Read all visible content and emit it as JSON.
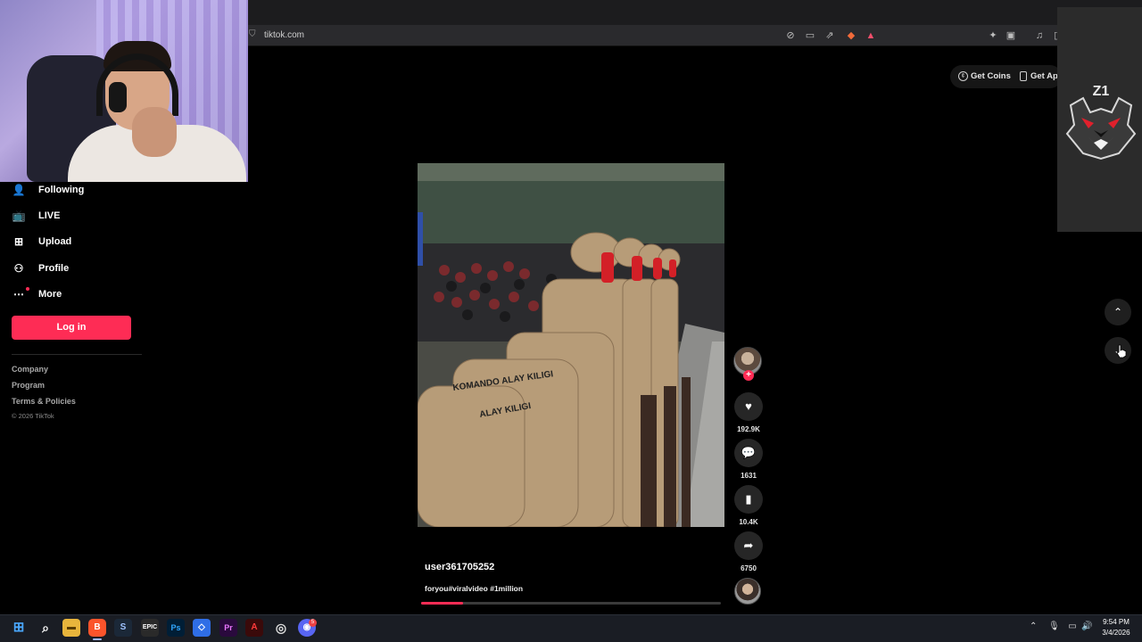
{
  "browser": {
    "url": "tiktok.com",
    "lock_icon": "shield-icon",
    "toolbar_icons": [
      "no-tracking-icon",
      "cast-icon",
      "share-icon",
      "brave-shield-icon",
      "brave-rewards-icon",
      "extensions-icon",
      "tab-icon",
      "media-icon",
      "sidebar-icon"
    ]
  },
  "sidebar": {
    "items": [
      {
        "label": "Following",
        "icon": "following-icon"
      },
      {
        "label": "LIVE",
        "icon": "live-icon"
      },
      {
        "label": "Upload",
        "icon": "upload-icon"
      },
      {
        "label": "Profile",
        "icon": "profile-icon"
      },
      {
        "label": "More",
        "icon": "more-icon"
      }
    ],
    "login_label": "Log in",
    "footer_links": [
      "Company",
      "Program",
      "Terms & Policies"
    ],
    "copyright": "© 2026 TikTok"
  },
  "header": {
    "get_coins": "Get Coins",
    "get_app": "Get App"
  },
  "overlay": {
    "logo_text": "Z1"
  },
  "video": {
    "author": "user361705252",
    "caption": "foryou#viralvideo #1million",
    "progress": 0.14,
    "banner_text_1": "KOMANDO ALAY KILIGI",
    "banner_text_2": "ALAY KILIGI"
  },
  "actions": {
    "likes": "192.9K",
    "comments": "1631",
    "saves": "10.4K",
    "shares": "6750",
    "follow_symbol": "+"
  },
  "taskbar": {
    "apps": [
      "Start",
      "Search",
      "File Explorer",
      "Brave",
      "Steam",
      "Epic Games",
      "Photoshop",
      "Roblox",
      "Premiere Pro",
      "Adobe",
      "Chrome",
      "Discord"
    ],
    "discord_badge": "5",
    "time": "9:54 PM",
    "date": "3/4/2026"
  },
  "colors": {
    "accent": "#fe2c55",
    "background": "#000000",
    "taskbar": "#1a1d24"
  }
}
